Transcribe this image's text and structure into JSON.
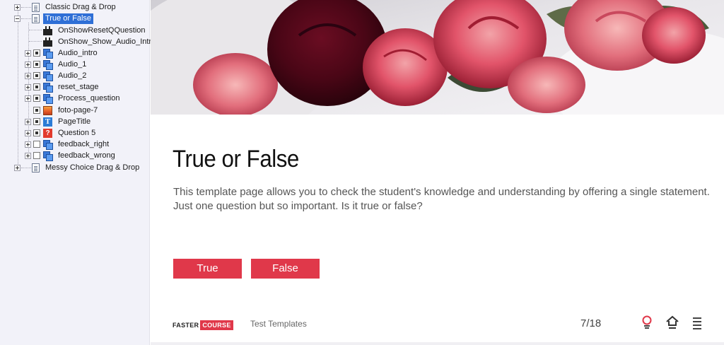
{
  "tree": {
    "items": [
      {
        "label": "Classic Drag & Drop"
      },
      {
        "label": "True or False"
      },
      {
        "label": "OnShowResetQQuestion"
      },
      {
        "label": "OnShow_Show_Audio_Intro"
      },
      {
        "label": "Audio_intro"
      },
      {
        "label": "Audio_1"
      },
      {
        "label": "Audio_2"
      },
      {
        "label": "reset_stage"
      },
      {
        "label": "Process_question"
      },
      {
        "label": "foto-page-7"
      },
      {
        "label": "PageTitle"
      },
      {
        "label": "Question 5"
      },
      {
        "label": "feedback_right"
      },
      {
        "label": "feedback_wrong"
      },
      {
        "label": "Messy Choice Drag & Drop"
      }
    ],
    "icons": {
      "page": "page-icon",
      "action": "action-icon",
      "audio": "audio-object-icon",
      "image": "image-icon",
      "text": "text-icon",
      "question": "question-icon"
    },
    "text_icon_glyph": "T",
    "question_icon_glyph": "?"
  },
  "page": {
    "title": "True or False",
    "description": "This template page allows you to check the student's knowledge and understanding by offering a single statement. Just one question but so important. Is it true or false?",
    "true_label": "True",
    "false_label": "False"
  },
  "footer": {
    "logo_part1": "FASTER",
    "logo_part2": "COURSE",
    "course_title": "Test Templates",
    "pager": "7/18",
    "icons": [
      "lightbulb-icon",
      "home-icon",
      "menu-icon"
    ]
  },
  "colors": {
    "accent": "#e0384a",
    "selection": "#2f6fd6",
    "tree_background": "#f2f2f9"
  }
}
